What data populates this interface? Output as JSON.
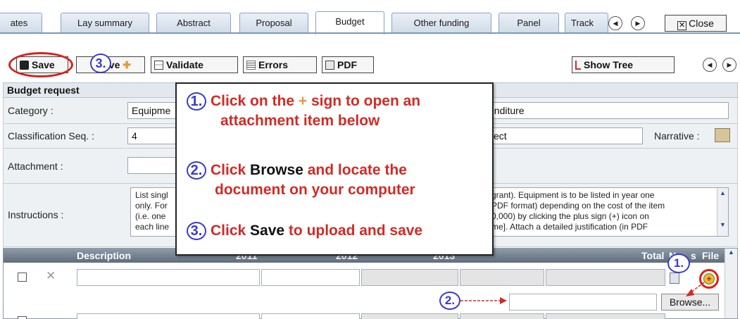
{
  "tabs": [
    {
      "label": "ates"
    },
    {
      "label": "Lay summary"
    },
    {
      "label": "Abstract"
    },
    {
      "label": "Proposal"
    },
    {
      "label": "Budget"
    },
    {
      "label": "Other funding"
    },
    {
      "label": "Panel"
    },
    {
      "label": "Track"
    }
  ],
  "close_label": "Close",
  "toolbar": {
    "save": "Save",
    "save_plus": "ave",
    "validate": "Validate",
    "errors": "Errors",
    "pdf": "PDF",
    "show_tree": "Show Tree"
  },
  "form": {
    "section_title": "Budget request",
    "category_label": "Category :",
    "category_value": "Equipme",
    "category_right": "enditure",
    "classification_label": "Classification Seq. :",
    "classification_value": "4",
    "classification_right": "ect",
    "narrative_label": "Narrative :",
    "attachment_label": "Attachment :",
    "instructions_label": "Instructions :",
    "instructions_left": "List singl\nonly. For\n(i.e. one\neach line",
    "instructions_right": "grant). Equipment is to be listed in year one\nPDF format) depending on the cost of the item\n0,000) by clicking the plus sign (+) icon on\nme]. Attach a detailed justification (in PDF"
  },
  "table": {
    "headers": {
      "description": "Description",
      "y1": "2011",
      "y2": "2012",
      "y3": "2013",
      "total": "Total",
      "notes": "N",
      "notes_tail": "s",
      "file": "File"
    },
    "browse_label": "Browse..."
  },
  "callout": {
    "step1_num": "1.",
    "step1_a": "Click on the ",
    "step1_plus": "+",
    "step1_b": " sign to open an",
    "step1_c": "attachment item below",
    "step2_num": "2.",
    "step2_a": "Click ",
    "step2_bold": "Browse",
    "step2_b": " and locate the",
    "step2_c": "document on your computer",
    "step3_num": "3.",
    "step3_a": "Click ",
    "step3_bold": "Save",
    "step3_b": " to upload and save"
  },
  "markers": {
    "m1": "1.",
    "m2": "2.",
    "m3": "3."
  },
  "colors": {
    "annotation_red": "#d02b26",
    "annotation_blue": "#3a3acb",
    "header_grey": "#6b7886"
  }
}
